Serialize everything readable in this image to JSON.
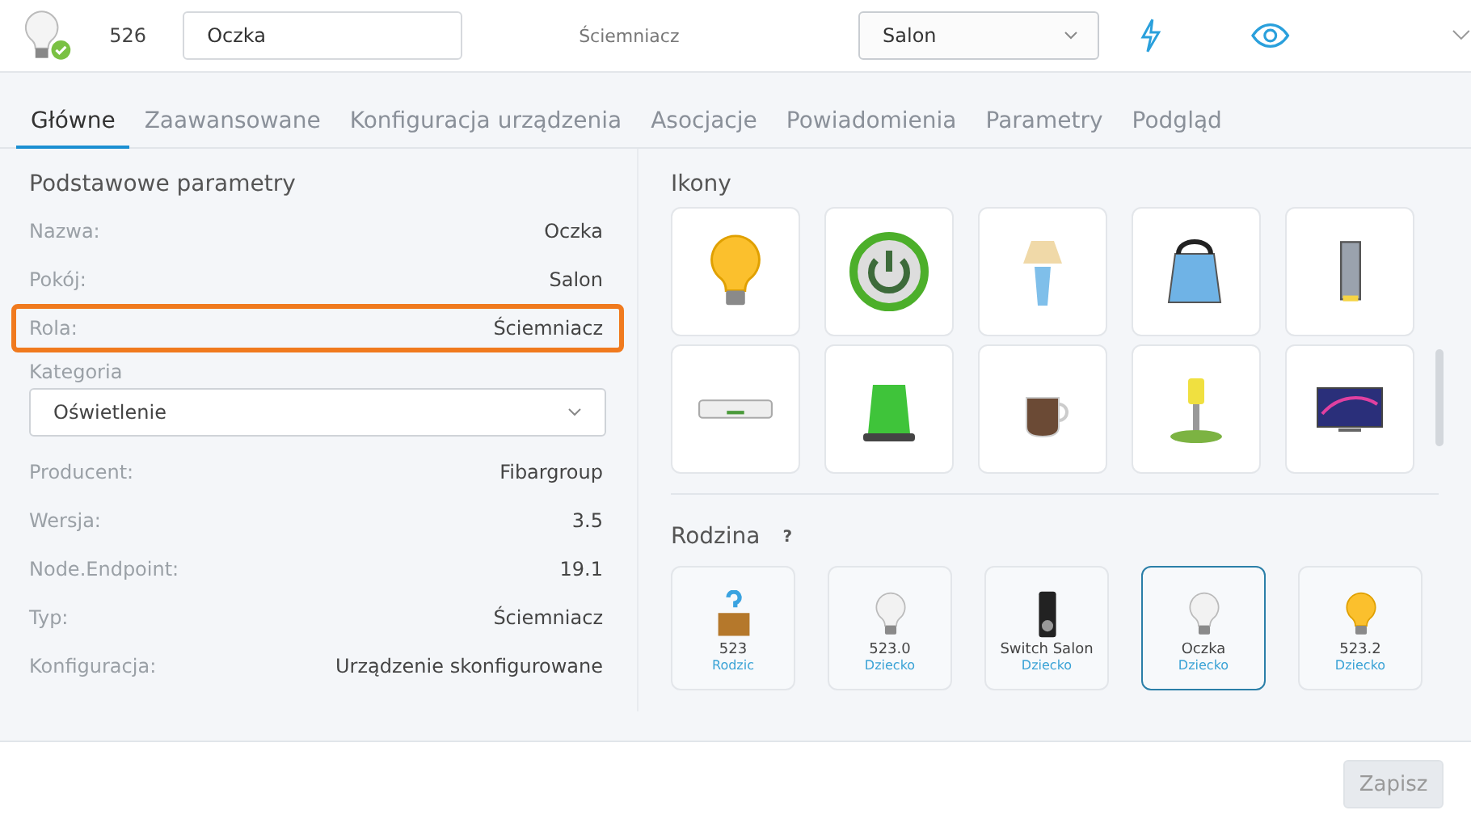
{
  "header": {
    "device_id": "526",
    "name_field": {
      "value": "Oczka"
    },
    "role": "Ściemniacz",
    "room_select": {
      "value": "Salon"
    }
  },
  "tabs": [
    {
      "label": "Główne",
      "selected": true
    },
    {
      "label": "Zaawansowane",
      "selected": false
    },
    {
      "label": "Konfiguracja urządzenia",
      "selected": false
    },
    {
      "label": "Asocjacje",
      "selected": false
    },
    {
      "label": "Powiadomienia",
      "selected": false
    },
    {
      "label": "Parametry",
      "selected": false
    },
    {
      "label": "Podgląd",
      "selected": false
    }
  ],
  "basic_parameters": {
    "title": "Podstawowe parametry",
    "rows": [
      {
        "kind": "text",
        "label": "Nazwa:",
        "value": "Oczka",
        "highlighted": false
      },
      {
        "kind": "text",
        "label": "Pokój:",
        "value": "Salon",
        "highlighted": false
      },
      {
        "kind": "text",
        "label": "Rola:",
        "value": "Ściemniacz",
        "highlighted": true
      },
      {
        "kind": "select",
        "label": "Kategoria",
        "value": "Oświetlenie"
      },
      {
        "kind": "text",
        "label": "Producent:",
        "value": "Fibargroup",
        "highlighted": false
      },
      {
        "kind": "text",
        "label": "Wersja:",
        "value": "3.5",
        "highlighted": false
      },
      {
        "kind": "text",
        "label": "Node.Endpoint:",
        "value": "19.1",
        "highlighted": false
      },
      {
        "kind": "text",
        "label": "Typ:",
        "value": "Ściemniacz",
        "highlighted": false
      },
      {
        "kind": "text",
        "label": "Konfiguracja:",
        "value": "Urządzenie skonfigurowane",
        "highlighted": false
      }
    ]
  },
  "icons": {
    "title": "Ikony"
  },
  "family": {
    "title": "Rodzina",
    "help": "?",
    "items": [
      {
        "name": "523",
        "relation": "Rodzic",
        "selected": false
      },
      {
        "name": "523.0",
        "relation": "Dziecko",
        "selected": false
      },
      {
        "name": "Switch Salon",
        "relation": "Dziecko",
        "selected": false
      },
      {
        "name": "Oczka",
        "relation": "Dziecko",
        "selected": true
      },
      {
        "name": "523.2",
        "relation": "Dziecko",
        "selected": false
      }
    ]
  },
  "save_button": {
    "label": "Zapisz",
    "disabled": true
  }
}
